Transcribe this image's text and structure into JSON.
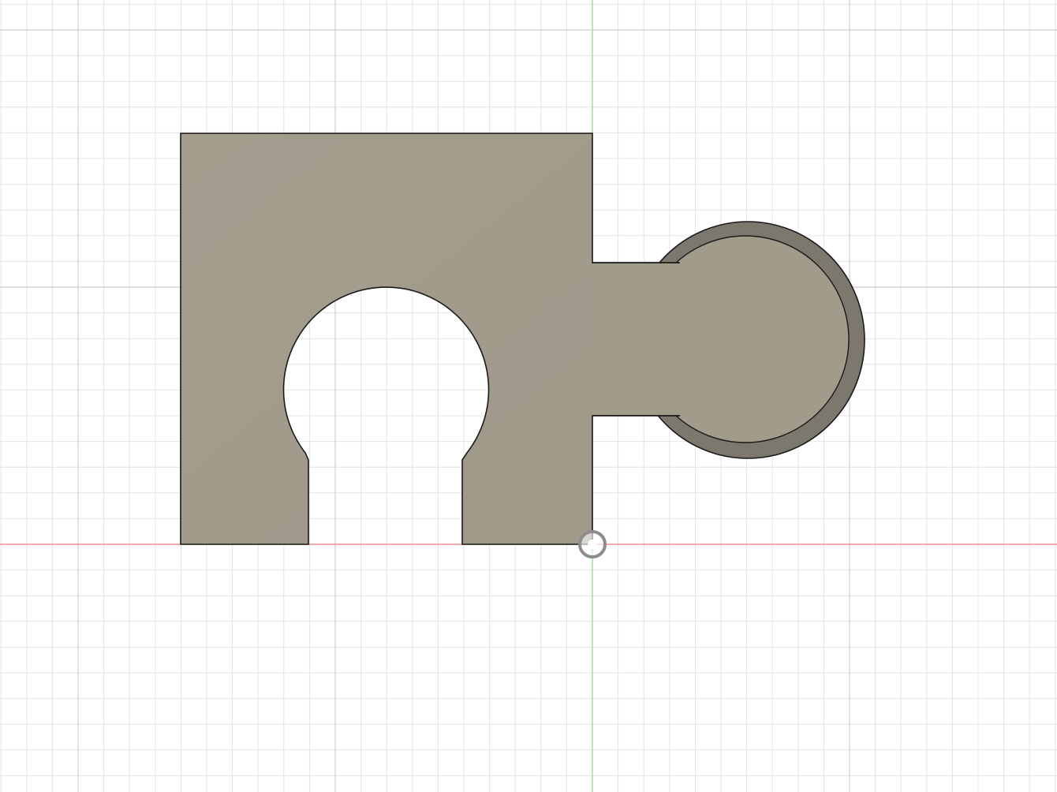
{
  "app": {
    "view": "sketch-canvas-top-view"
  },
  "canvas": {
    "background_color": "#ffffff",
    "grid": {
      "visible": true,
      "minor_line_color": "#e4e4e4",
      "major_line_color": "#cfcfcf"
    },
    "axes": {
      "x_axis_color": "#f08080",
      "y_axis_color": "#8fe08f"
    }
  },
  "body": {
    "name": "body-profile",
    "face_color": "#a19b8c",
    "edge_color": "#1a1a1a",
    "boss": {
      "rim_color": "#7c786e",
      "face_color": "#a19b8c"
    }
  },
  "origin_marker": {
    "icon": "origin-circle-icon",
    "color": "#8c8c8c"
  }
}
